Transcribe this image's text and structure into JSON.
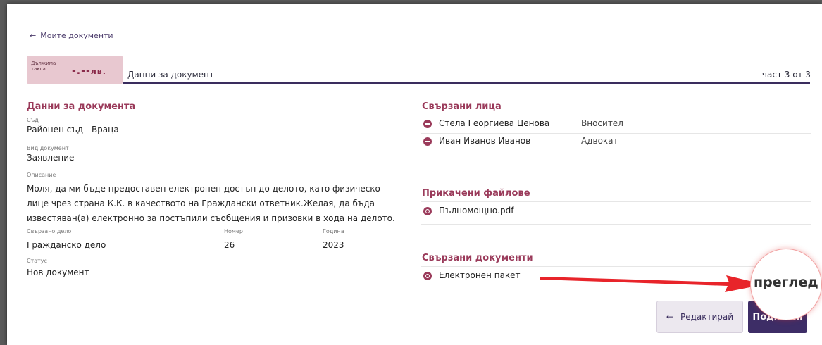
{
  "nav": {
    "back_link": "Моите документи"
  },
  "fee": {
    "label": "Дължима такса",
    "value": "-.--",
    "currency": "лв."
  },
  "header": {
    "title": "Данни за документ",
    "step": "част 3 от 3"
  },
  "left": {
    "heading": "Данни за документа",
    "court_label": "Съд",
    "court_value": "Районен съд - Враца",
    "doctype_label": "Вид документ",
    "doctype_value": "Заявление",
    "desc_label": "Описание",
    "desc_value": "Моля, да ми бъде предоставен електронен достъп до делото, като физическо лице чрез страна К.К. в качеството на Граждански ответник.Желая, да бъда известяван(а) електронно за постъпили съобщения и призовки в хода на делото.",
    "case_label": "Свързано дело",
    "case_value": "Гражданско дело",
    "number_label": "Номер",
    "number_value": "26",
    "year_label": "Година",
    "year_value": "2023",
    "status_label": "Статус",
    "status_value": "Нов документ"
  },
  "right": {
    "persons_heading": "Свързани лица",
    "persons": [
      {
        "name": "Стела Георгиева Ценова",
        "role": "Вносител"
      },
      {
        "name": "Иван Иванов Иванов",
        "role": "Адвокат"
      }
    ],
    "files_heading": "Прикачени файлове",
    "files": [
      {
        "name": "Пълномощно.pdf"
      }
    ],
    "docs_heading": "Свързани документи",
    "docs": [
      {
        "name": "Електронен пакет"
      }
    ]
  },
  "overlay": {
    "preview_label": "преглед"
  },
  "actions": {
    "edit_label": "Редактирай",
    "sign_label": "Подпиши"
  }
}
